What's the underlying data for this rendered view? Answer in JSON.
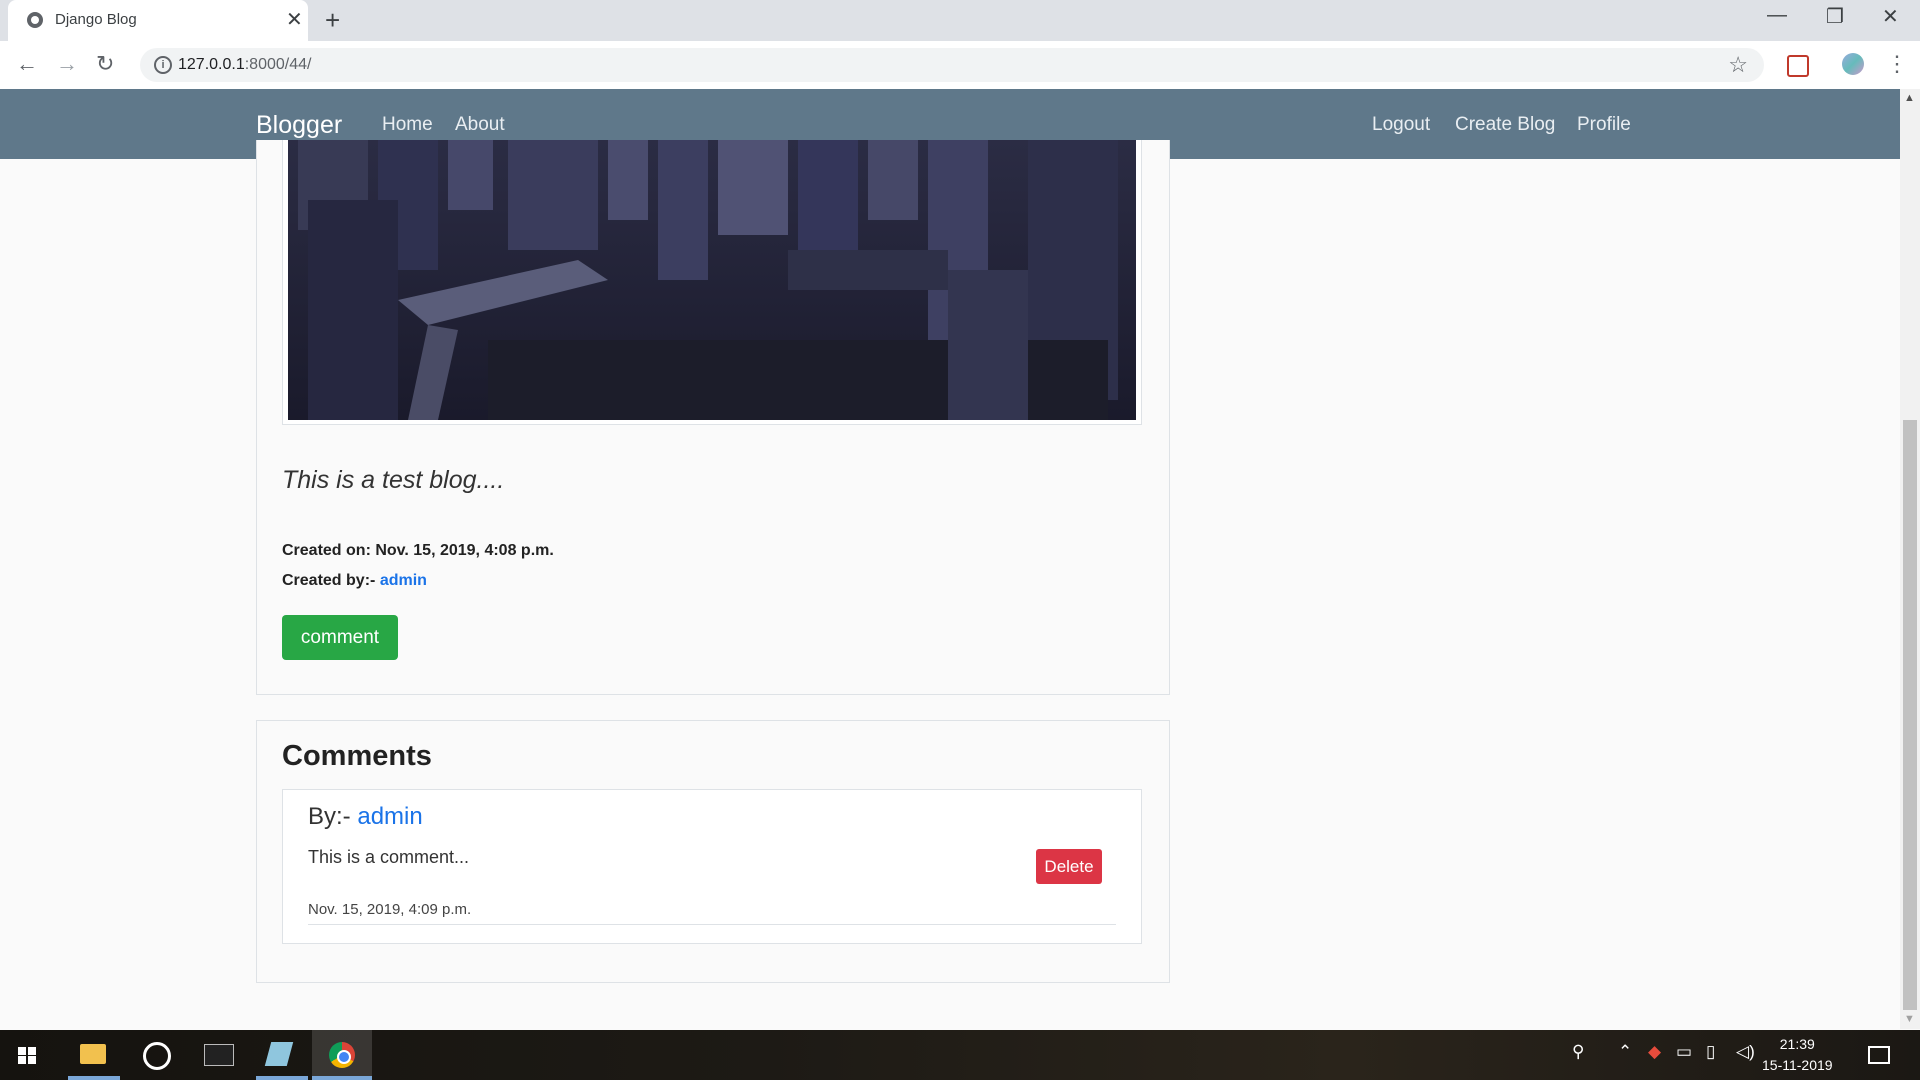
{
  "browser": {
    "tab_title": "Django Blog",
    "url_host": "127.0.0.1",
    "url_path": ":8000/44/"
  },
  "navbar": {
    "brand": "Blogger",
    "left_links": [
      "Home",
      "About"
    ],
    "right_links": [
      "Logout",
      "Create Blog",
      "Profile"
    ],
    "color": "#5f788a"
  },
  "post": {
    "body": "This is a test blog....",
    "created_on_label": "Created on: Nov. 15, 2019, 4:08 p.m.",
    "created_by_label": "Created by:-",
    "author": "admin",
    "comment_button": "comment"
  },
  "comments": {
    "title": "Comments",
    "items": [
      {
        "by_label": "By:-",
        "author": "admin",
        "text": "This is a comment...",
        "delete_label": "Delete",
        "date": "Nov. 15, 2019, 4:09 p.m."
      }
    ]
  },
  "taskbar": {
    "time": "21:39",
    "date": "15-11-2019"
  },
  "colors": {
    "success": "#28a745",
    "danger": "#dc3545",
    "link": "#1a73e8"
  }
}
